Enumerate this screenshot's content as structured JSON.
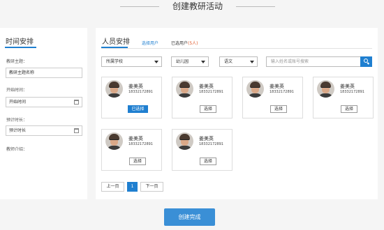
{
  "page": {
    "title": "创建教研活动"
  },
  "time_panel": {
    "title": "时间安排",
    "fields": [
      {
        "label": "教研主题：",
        "value": "教研主题名称"
      },
      {
        "label": "开始时间：",
        "value": "开始时间"
      },
      {
        "label": "预计时长：",
        "value": "预计时长"
      },
      {
        "label": "教师介绍：",
        "value": ""
      }
    ]
  },
  "staff_panel": {
    "title": "人员安排",
    "tabs": [
      {
        "label": "选择用户"
      },
      {
        "label": "已选用户",
        "count": "(5人)"
      }
    ],
    "filters": {
      "school": "所属学校",
      "grade": "幼儿园",
      "subject": "语文",
      "search_placeholder": "输入姓名或账号搜索"
    },
    "cards": [
      {
        "name": "姜美英",
        "phone": "18332172891",
        "button": "已选择",
        "selected": true
      },
      {
        "name": "姜美英",
        "phone": "18332172891",
        "button": "选择",
        "selected": false
      },
      {
        "name": "姜美英",
        "phone": "18332172891",
        "button": "选择",
        "selected": false
      },
      {
        "name": "姜美英",
        "phone": "18332172891",
        "button": "选择",
        "selected": false
      },
      {
        "name": "姜美英",
        "phone": "18332172891",
        "button": "选择",
        "selected": false
      },
      {
        "name": "姜美英",
        "phone": "18332172891",
        "button": "选择",
        "selected": false
      }
    ],
    "pagination": {
      "prev": "上一页",
      "current": "1",
      "next": "下一页"
    }
  },
  "actions": {
    "create": "创建完成"
  },
  "colors": {
    "accent": "#1f7fd0",
    "count": "#e05a2b"
  }
}
